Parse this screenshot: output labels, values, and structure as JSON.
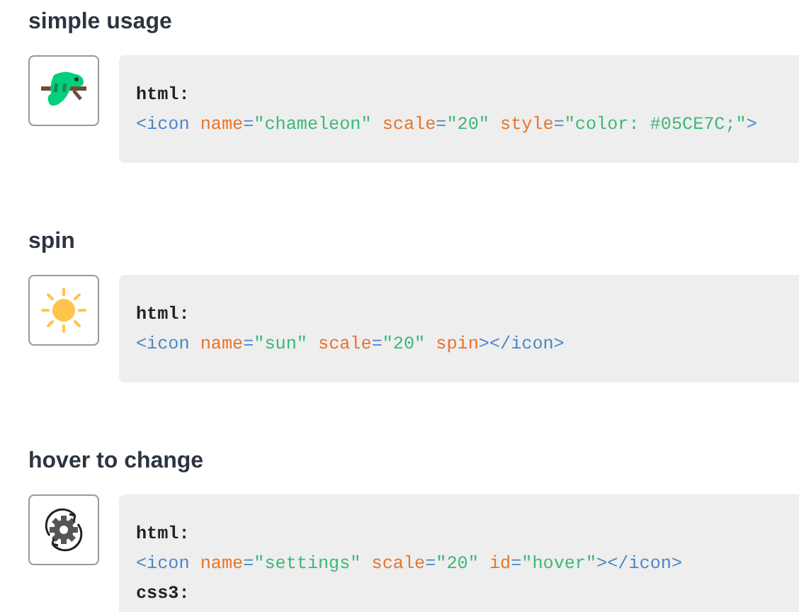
{
  "sections": [
    {
      "title": "simple usage",
      "kind": "chameleon",
      "lines": [
        {
          "kind": "label",
          "text": "html:"
        },
        {
          "kind": "code",
          "tokens": [
            {
              "kind": "tag",
              "s": "<icon"
            },
            {
              "kind": "attr",
              "s": " name"
            },
            {
              "kind": "eq",
              "s": "="
            },
            {
              "kind": "value",
              "s": "\"chameleon\""
            },
            {
              "kind": "attr",
              "s": " scale"
            },
            {
              "kind": "eq",
              "s": "="
            },
            {
              "kind": "value",
              "s": "\"20\""
            },
            {
              "kind": "attr",
              "s": " style"
            },
            {
              "kind": "eq",
              "s": "="
            },
            {
              "kind": "value",
              "s": "\"color: #05CE7C;\""
            },
            {
              "kind": "tag",
              "s": ">"
            }
          ]
        }
      ]
    },
    {
      "title": "spin",
      "kind": "sun",
      "lines": [
        {
          "kind": "label",
          "text": "html:"
        },
        {
          "kind": "code",
          "tokens": [
            {
              "kind": "tag",
              "s": "<icon"
            },
            {
              "kind": "attr",
              "s": " name"
            },
            {
              "kind": "eq",
              "s": "="
            },
            {
              "kind": "value",
              "s": "\"sun\""
            },
            {
              "kind": "attr",
              "s": " scale"
            },
            {
              "kind": "eq",
              "s": "="
            },
            {
              "kind": "value",
              "s": "\"20\""
            },
            {
              "kind": "attr",
              "s": " spin"
            },
            {
              "kind": "tag",
              "s": "></icon>"
            }
          ]
        }
      ]
    },
    {
      "title": "hover to change",
      "kind": "settings",
      "lines": [
        {
          "kind": "label",
          "text": "html:"
        },
        {
          "kind": "code",
          "tokens": [
            {
              "kind": "tag",
              "s": "<icon"
            },
            {
              "kind": "attr",
              "s": " name"
            },
            {
              "kind": "eq",
              "s": "="
            },
            {
              "kind": "value",
              "s": "\"settings\""
            },
            {
              "kind": "attr",
              "s": " scale"
            },
            {
              "kind": "eq",
              "s": "="
            },
            {
              "kind": "value",
              "s": "\"20\""
            },
            {
              "kind": "attr",
              "s": " id"
            },
            {
              "kind": "eq",
              "s": "="
            },
            {
              "kind": "value",
              "s": "\"hover\""
            },
            {
              "kind": "tag",
              "s": "></icon>"
            }
          ]
        },
        {
          "kind": "label",
          "text": "css3:"
        }
      ]
    }
  ]
}
